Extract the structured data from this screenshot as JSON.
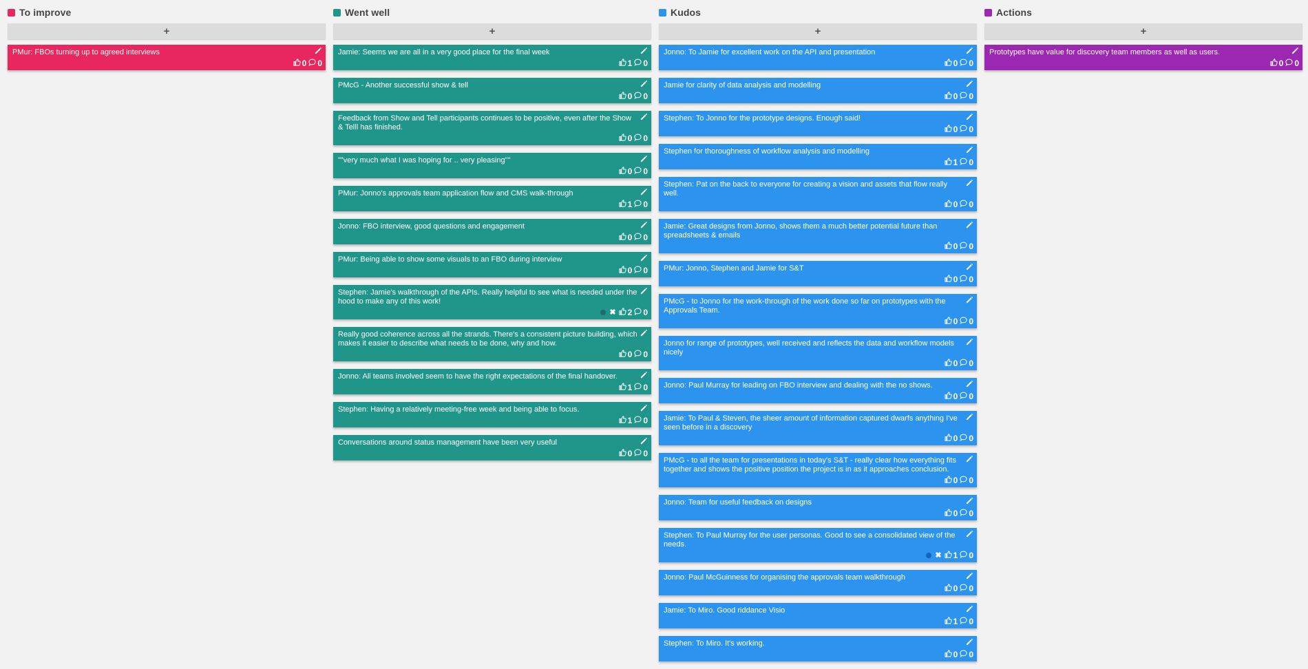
{
  "columns": [
    {
      "id": "to-improve",
      "title": "To improve",
      "color": "#e8275e",
      "add_label": "+",
      "cards": [
        {
          "text": "PMur: FBOs turning up to agreed interviews",
          "likes": "0",
          "comments": "0"
        }
      ]
    },
    {
      "id": "went-well",
      "title": "Went well",
      "color": "#20958a",
      "extra_color": "#1d6e66",
      "add_label": "+",
      "cards": [
        {
          "text": "Jamie: Seems we are all in a very good place for the final week",
          "likes": "1",
          "comments": "0"
        },
        {
          "text": "PMcG - Another successful show & tell",
          "likes": "0",
          "comments": "0"
        },
        {
          "text": "Feedback from Show and Tell participants continues to be positive, even after the Show & Telll has finished.",
          "likes": "0",
          "comments": "0"
        },
        {
          "text": "\"\"very much what I was hoping for .. very pleasing\"\"",
          "likes": "0",
          "comments": "0"
        },
        {
          "text": "PMur: Jonno's approvals team application flow and CMS walk-through",
          "likes": "1",
          "comments": "0"
        },
        {
          "text": "Jonno: FBO interview, good questions and engagement",
          "likes": "0",
          "comments": "0"
        },
        {
          "text": "PMur: Being able to show some visuals to an FBO during interview",
          "likes": "0",
          "comments": "0"
        },
        {
          "text": "Stephen: Jamie's walkthrough of the APIs. Really helpful to see what is needed under the hood to make any of this work!",
          "likes": "2",
          "comments": "0",
          "extra": true
        },
        {
          "text": "Really good coherence across all the strands. There's a consistent picture building, which makes it easier to describe what needs to be done, why and how.",
          "likes": "0",
          "comments": "0"
        },
        {
          "text": "Jonno: All teams involved seem to have the right expectations of the final handover.",
          "likes": "1",
          "comments": "0"
        },
        {
          "text": "Stephen: Having a relatively meeting-free week and being able to focus.",
          "likes": "1",
          "comments": "0"
        },
        {
          "text": "Conversations around status management have been very useful",
          "likes": "0",
          "comments": "0"
        }
      ]
    },
    {
      "id": "kudos",
      "title": "Kudos",
      "color": "#2c94ee",
      "extra_color": "#1565c0",
      "add_label": "+",
      "cards": [
        {
          "text": "Jonno: To Jamie for excellent work on the API and presentation",
          "likes": "0",
          "comments": "0"
        },
        {
          "text": "Jamie for clarity of data analysis and modelling",
          "likes": "0",
          "comments": "0"
        },
        {
          "text": "Stephen: To Jonno for the prototype designs. Enough said!",
          "likes": "0",
          "comments": "0"
        },
        {
          "text": "Stephen for thoroughness of workflow analysis and modelling",
          "likes": "1",
          "comments": "0"
        },
        {
          "text": "Stephen: Pat on the back to everyone for creating a vision and assets that flow really well.",
          "likes": "0",
          "comments": "0"
        },
        {
          "text": "Jamie: Great designs from Jonno, shows them a much better potential future than spreadsheets & emails",
          "likes": "0",
          "comments": "0"
        },
        {
          "text": "PMur: Jonno, Stephen and Jamie for S&T",
          "likes": "0",
          "comments": "0"
        },
        {
          "text": "PMcG - to Jonno for the work-through of the work done so far on prototypes with the Approvals Team.",
          "likes": "0",
          "comments": "0"
        },
        {
          "text": "Jonno for range of prototypes, well received and reflects the data and workflow models nicely",
          "likes": "0",
          "comments": "0"
        },
        {
          "text": "Jonno: Paul Murray for leading on FBO interview and dealing with the no shows.",
          "likes": "0",
          "comments": "0"
        },
        {
          "text": "Jamie: To Paul & Steven, the sheer amount of information captured dwarfs anything I've seen before in a discovery",
          "likes": "0",
          "comments": "0"
        },
        {
          "text": "PMcG - to all the team for presentations in today's S&T - really clear how everything fits together and shows the positive position the project is in as it approaches conclusion.",
          "likes": "0",
          "comments": "0"
        },
        {
          "text": "Jonno: Team for useful feedback on designs",
          "likes": "0",
          "comments": "0"
        },
        {
          "text": "Stephen: To Paul Murray for the user personas. Good to see a consolidated view of the needs.",
          "likes": "1",
          "comments": "0",
          "extra": true
        },
        {
          "text": "Jonno: Paul McGuinness for organising the approvals team walkthrough",
          "likes": "0",
          "comments": "0"
        },
        {
          "text": "Jamie: To Miro. Good riddance Visio",
          "likes": "1",
          "comments": "0"
        },
        {
          "text": "Stephen: To Miro. It's working.",
          "likes": "0",
          "comments": "0"
        }
      ]
    },
    {
      "id": "actions",
      "title": "Actions",
      "color": "#9c27b0",
      "add_label": "+",
      "cards": [
        {
          "text": "Prototypes have value for discovery team members as well as users.",
          "likes": "0",
          "comments": "0"
        }
      ]
    }
  ]
}
